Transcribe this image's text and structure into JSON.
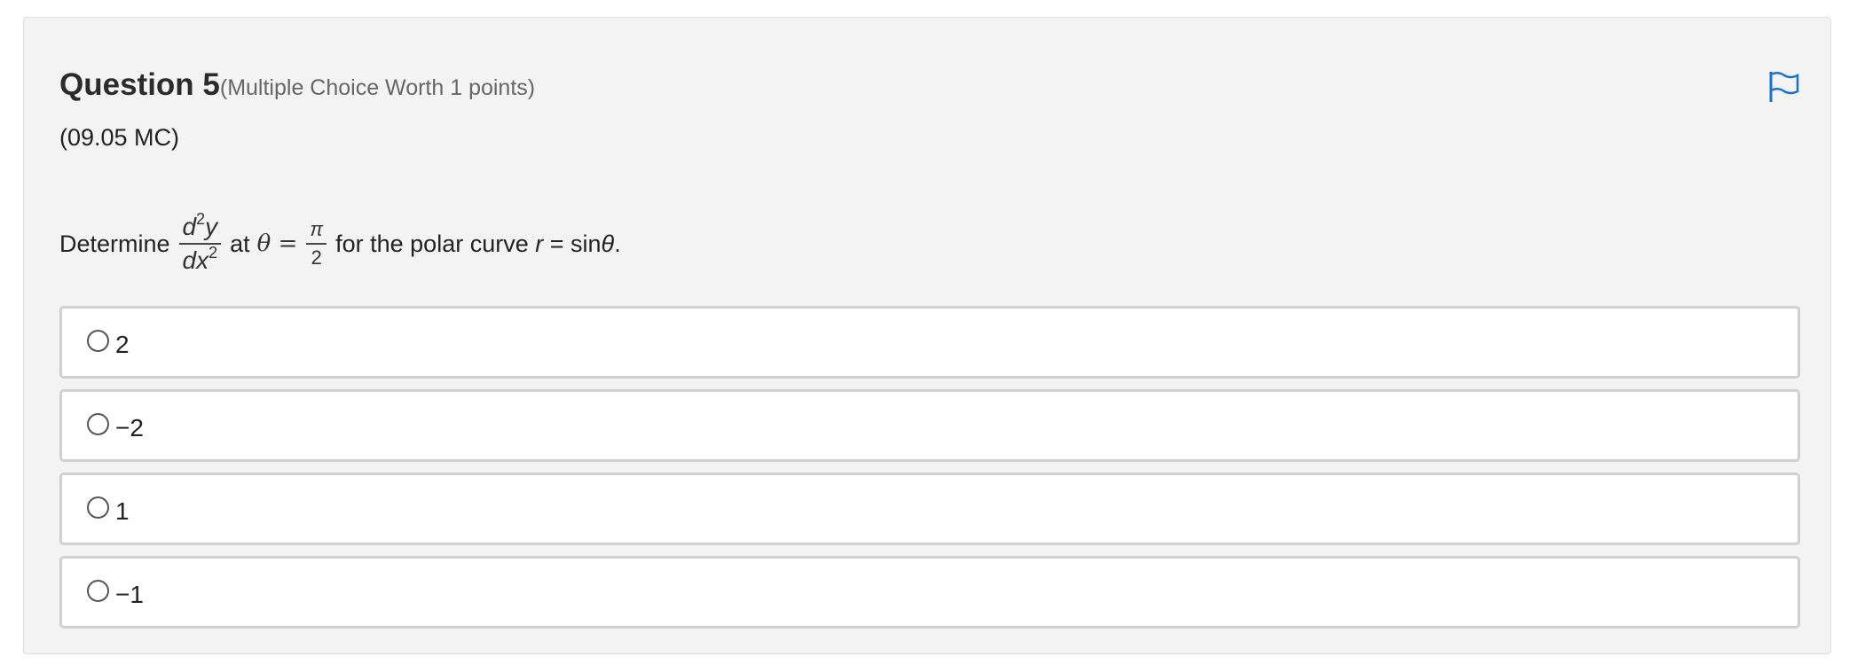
{
  "question": {
    "title": "Question 5",
    "meta": "(Multiple Choice Worth 1 points)",
    "code": "(09.05 MC)"
  },
  "flag_icon": "flag-icon",
  "accent_color": "#1a73c9",
  "stem": {
    "prefix": "Determine",
    "deriv_num_d": "d",
    "deriv_num_exp": "2",
    "deriv_num_y": "y",
    "deriv_den_dx": "dx",
    "deriv_den_exp": "2",
    "at": "at",
    "theta_eq": "θ =",
    "frac_num": "π",
    "frac_den": "2",
    "middle": "for the polar curve",
    "r": "r",
    "equation": " = sin",
    "theta": "θ",
    "end": "."
  },
  "options": [
    {
      "label": "2"
    },
    {
      "label": "−2"
    },
    {
      "label": "1"
    },
    {
      "label": "−1"
    }
  ]
}
